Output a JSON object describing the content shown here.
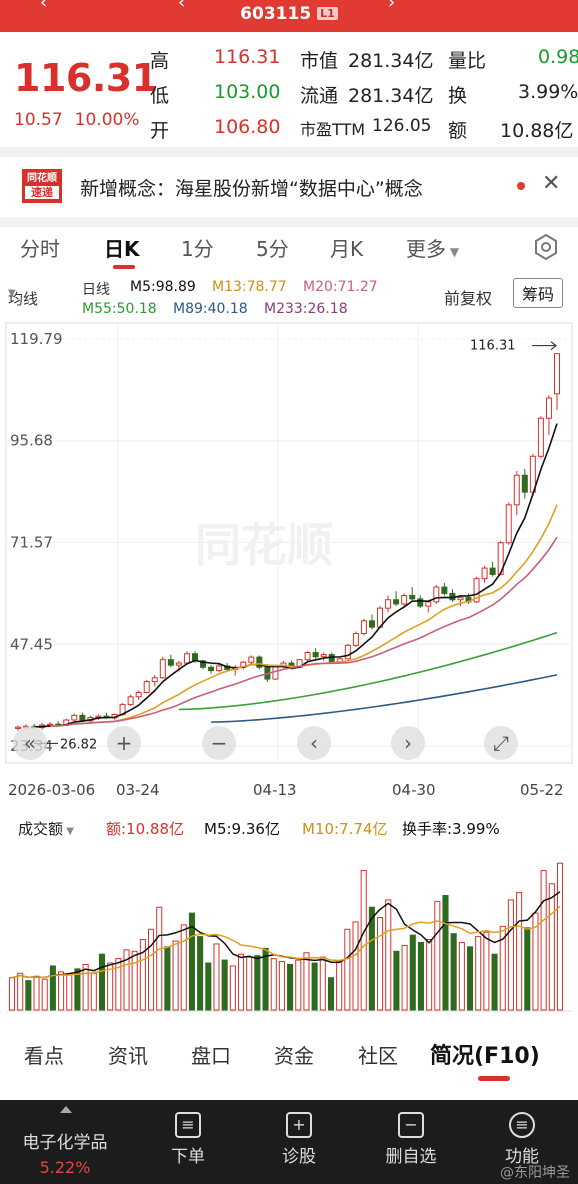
{
  "header": {
    "code": "603115",
    "level": "L1"
  },
  "quote": {
    "price": "116.31",
    "change": "10.57",
    "change_pct": "10.00%",
    "rows": [
      {
        "l1": "高",
        "v1": "116.31",
        "l2": "市值",
        "v2": "281.34亿",
        "l3": "量比",
        "v3": "0.98"
      },
      {
        "l1": "低",
        "v1": "103.00",
        "l2": "流通",
        "v2": "281.34亿",
        "l3": "换",
        "v3": "3.99%"
      },
      {
        "l1": "开",
        "v1": "106.80",
        "l2": "市盈TTM",
        "v2": "126.05",
        "l3": "额",
        "v3": "10.88亿"
      }
    ]
  },
  "news": {
    "logo_top": "同花顺",
    "logo_bottom": "速递",
    "text": "新增概念：海星股份新增“数据中心”概念"
  },
  "period_tabs": [
    "分时",
    "日K",
    "1分",
    "5分",
    "月K",
    "更多"
  ],
  "indicators": {
    "avg_btn": "均线",
    "line_label": "日线",
    "m5": "M5:98.89",
    "m13": "M13:78.77",
    "m20": "M20:71.27",
    "m55": "M55:50.18",
    "m89": "M89:40.18",
    "m233": "M233:26.18",
    "fuquan": "前复权",
    "chouma": "筹码"
  },
  "chart_labels": {
    "y_ticks": [
      "119.79",
      "95.68",
      "71.57",
      "47.45",
      "23.34"
    ],
    "high_marker": "116.31",
    "low_marker": "26.82",
    "dates": [
      "2026-03-06",
      "03-24",
      "04-13",
      "04-30",
      "05-22"
    ],
    "watermark": "同花顺"
  },
  "volume": {
    "label": "成交额",
    "amount": "额:10.88亿",
    "m5": "M5:9.36亿",
    "m10": "M10:7.74亿",
    "turnover": "换手率:3.99%"
  },
  "lower_tabs": [
    "看点",
    "资讯",
    "盘口",
    "资金",
    "社区",
    "简况(F10)"
  ],
  "bottom_bar": {
    "sector": "电子化学品",
    "sector_pct": "5.22%",
    "items": [
      "下单",
      "诊股",
      "删自选",
      "功能"
    ],
    "watermark": "@东阳坤圣"
  },
  "colors": {
    "up": "#d8312b",
    "down": "#2e6b1f",
    "m5": "#111111",
    "m13": "#e0a020",
    "m20": "#c8607a",
    "m55": "#3aa03a",
    "m89": "#2a5a8a",
    "m233": "#8a3a7a"
  },
  "chart_data": {
    "type": "candlestick",
    "price_axis": [
      23.34,
      119.79
    ],
    "high": 116.31,
    "low": 26.82,
    "candles": [
      [
        27.5,
        28.2,
        27.0,
        27.8
      ],
      [
        27.8,
        28.5,
        27.3,
        28.0
      ],
      [
        28.0,
        28.6,
        27.5,
        27.7
      ],
      [
        27.7,
        28.8,
        27.2,
        28.3
      ],
      [
        28.3,
        29.0,
        27.9,
        28.5
      ],
      [
        28.5,
        29.2,
        28.0,
        28.2
      ],
      [
        28.2,
        29.8,
        28.0,
        29.5
      ],
      [
        29.5,
        31.0,
        29.2,
        30.6
      ],
      [
        30.6,
        31.2,
        29.0,
        29.3
      ],
      [
        29.3,
        30.5,
        28.8,
        30.1
      ],
      [
        30.1,
        30.8,
        29.5,
        30.4
      ],
      [
        30.4,
        31.2,
        29.8,
        30.0
      ],
      [
        30.0,
        31.0,
        29.6,
        30.8
      ],
      [
        30.8,
        33.5,
        30.5,
        33.2
      ],
      [
        33.2,
        35.5,
        32.8,
        35.0
      ],
      [
        35.0,
        36.5,
        34.2,
        36.0
      ],
      [
        36.0,
        39.0,
        35.8,
        38.6
      ],
      [
        38.6,
        40.2,
        37.5,
        39.5
      ],
      [
        39.5,
        44.5,
        39.2,
        43.8
      ],
      [
        43.8,
        45.0,
        42.0,
        42.5
      ],
      [
        42.5,
        43.5,
        41.0,
        43.0
      ],
      [
        43.0,
        45.8,
        42.6,
        45.2
      ],
      [
        45.2,
        45.8,
        43.0,
        43.5
      ],
      [
        43.5,
        43.8,
        41.5,
        42.0
      ],
      [
        42.0,
        42.5,
        40.5,
        41.2
      ],
      [
        41.2,
        42.8,
        40.8,
        42.3
      ],
      [
        42.3,
        43.0,
        41.0,
        41.5
      ],
      [
        41.5,
        42.5,
        40.0,
        42.0
      ],
      [
        42.0,
        43.5,
        41.5,
        43.2
      ],
      [
        43.2,
        44.8,
        42.5,
        44.4
      ],
      [
        44.4,
        44.8,
        41.5,
        42.0
      ],
      [
        42.0,
        42.8,
        38.5,
        39.2
      ],
      [
        39.2,
        42.5,
        39.0,
        42.2
      ],
      [
        42.2,
        43.5,
        41.8,
        43.0
      ],
      [
        43.0,
        43.6,
        41.5,
        42.0
      ],
      [
        42.0,
        44.0,
        41.8,
        43.8
      ],
      [
        43.8,
        45.8,
        43.5,
        45.5
      ],
      [
        45.5,
        46.5,
        44.0,
        44.5
      ],
      [
        44.5,
        45.5,
        43.5,
        45.0
      ],
      [
        45.0,
        45.5,
        43.0,
        43.3
      ],
      [
        43.3,
        44.5,
        43.0,
        44.0
      ],
      [
        44.0,
        47.5,
        43.8,
        47.2
      ],
      [
        47.2,
        50.5,
        46.8,
        50.0
      ],
      [
        50.0,
        53.5,
        49.5,
        53.0
      ],
      [
        53.0,
        54.5,
        51.0,
        51.5
      ],
      [
        51.5,
        56.5,
        51.2,
        56.0
      ],
      [
        56.0,
        59.0,
        55.0,
        58.0
      ],
      [
        58.0,
        60.0,
        56.5,
        57.0
      ],
      [
        57.0,
        59.5,
        56.0,
        59.0
      ],
      [
        59.0,
        61.0,
        57.5,
        58.2
      ],
      [
        58.2,
        59.0,
        56.0,
        56.5
      ],
      [
        56.5,
        58.0,
        55.0,
        57.5
      ],
      [
        57.5,
        61.5,
        57.0,
        61.0
      ],
      [
        61.0,
        62.0,
        59.0,
        59.5
      ],
      [
        59.5,
        60.5,
        57.5,
        58.0
      ],
      [
        58.0,
        59.0,
        56.5,
        58.5
      ],
      [
        58.5,
        59.5,
        57.0,
        57.5
      ],
      [
        57.5,
        63.5,
        57.2,
        63.0
      ],
      [
        63.0,
        66.0,
        62.0,
        65.5
      ],
      [
        65.5,
        67.0,
        63.5,
        64.0
      ],
      [
        64.0,
        72.0,
        63.8,
        71.5
      ],
      [
        71.5,
        81.0,
        71.0,
        80.5
      ],
      [
        80.5,
        88.5,
        78.0,
        87.5
      ],
      [
        87.5,
        89.0,
        82.0,
        83.5
      ],
      [
        83.5,
        92.5,
        82.5,
        92.0
      ],
      [
        92.0,
        101.5,
        91.5,
        101.0
      ],
      [
        101.0,
        106.5,
        97.0,
        105.8
      ],
      [
        106.8,
        116.31,
        103.0,
        116.31
      ]
    ]
  }
}
